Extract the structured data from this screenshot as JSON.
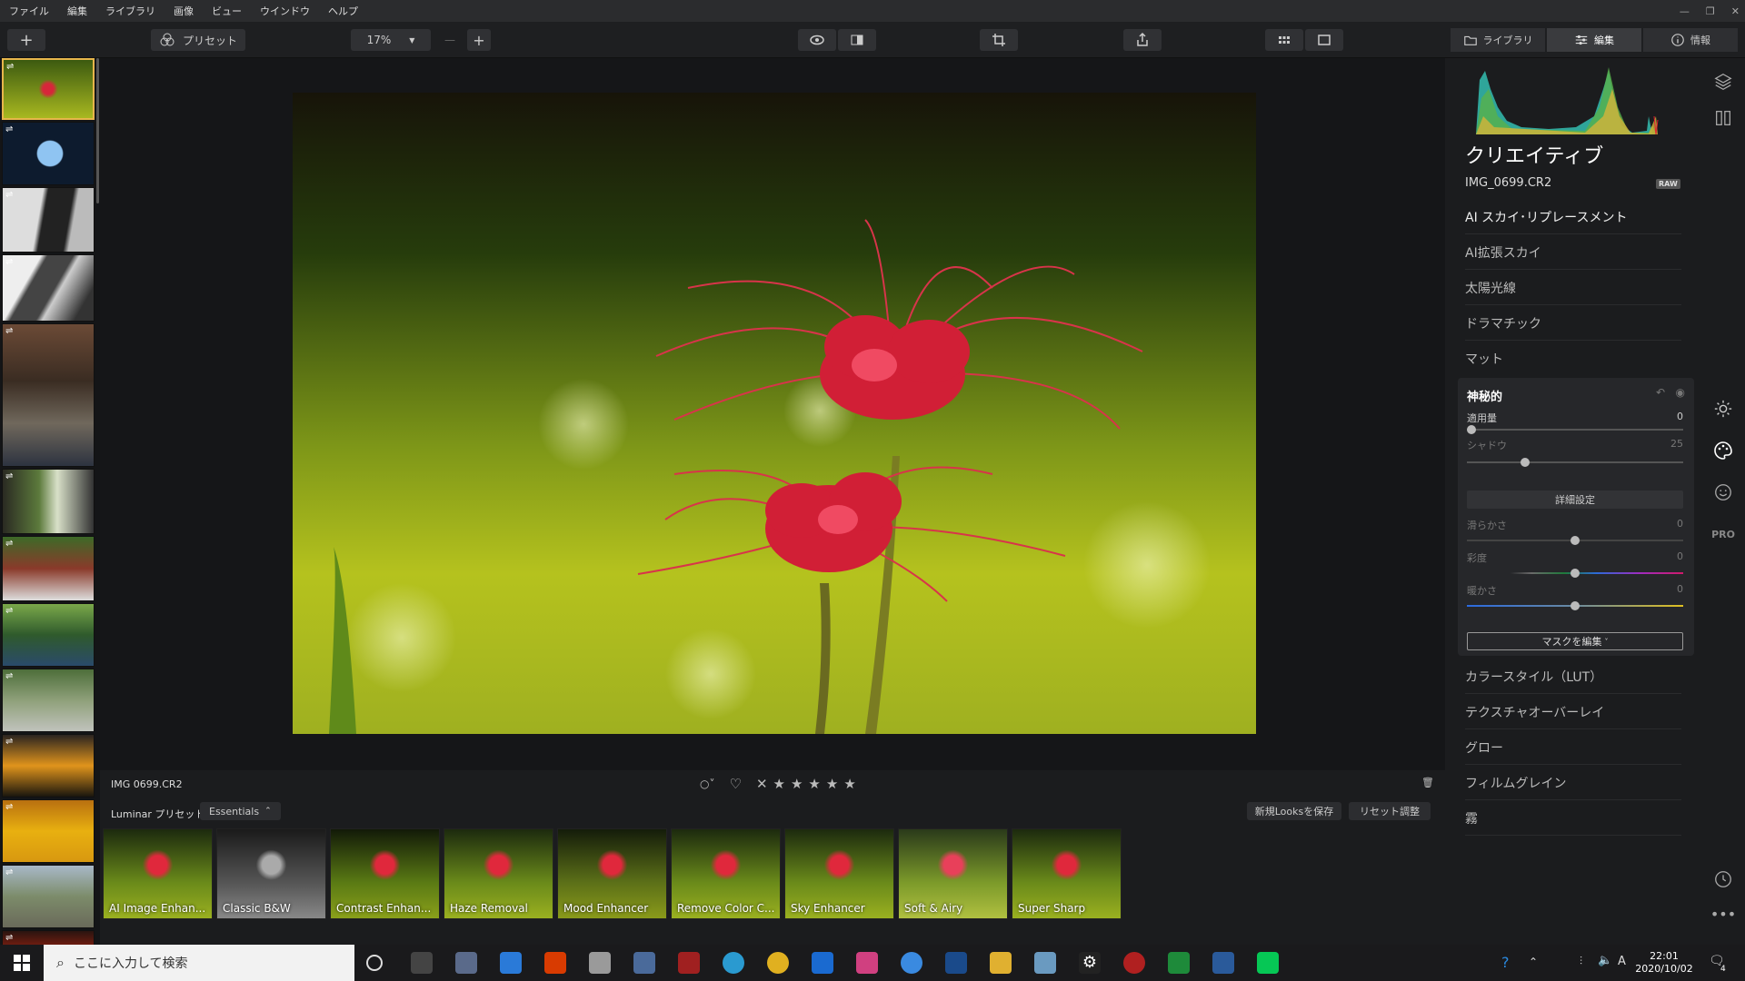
{
  "menu": [
    "ファイル",
    "編集",
    "ライブラリ",
    "画像",
    "ビュー",
    "ウインドウ",
    "ヘルプ"
  ],
  "toolbar": {
    "preset_label": "プリセット",
    "zoom": "17%",
    "tab_library": "ライブラリ",
    "tab_edit": "編集",
    "tab_info": "情報"
  },
  "viewer": {
    "filename": "IMG 0699.CR2"
  },
  "presetbar": {
    "title": "Luminar プリセット",
    "category": "Essentials",
    "save_looks": "新規Looksを保存",
    "reset": "リセット調整"
  },
  "presets": [
    {
      "label": "AI Image Enhan..."
    },
    {
      "label": "Classic B&W"
    },
    {
      "label": "Contrast Enhan..."
    },
    {
      "label": "Haze Removal"
    },
    {
      "label": "Mood Enhancer"
    },
    {
      "label": "Remove Color C..."
    },
    {
      "label": "Sky Enhancer"
    },
    {
      "label": "Soft & Airy"
    },
    {
      "label": "Super Sharp"
    }
  ],
  "panel": {
    "title": "クリエイティブ",
    "image_name": "IMG_0699.CR2",
    "raw_badge": "RAW",
    "tools_top": [
      "AI スカイ･リプレースメント",
      "AI拡張スカイ",
      "太陽光線",
      "ドラマチック",
      "マット"
    ],
    "mystic": {
      "title": "神秘的",
      "amount_label": "適用量",
      "amount_value": "0",
      "shadow_label": "シャドウ",
      "shadow_value": "25",
      "advanced": "詳細設定",
      "smooth_label": "滑らかさ",
      "smooth_value": "0",
      "saturation_label": "彩度",
      "saturation_value": "0",
      "warmth_label": "暖かさ",
      "warmth_value": "0",
      "edit_mask": "マスクを編集"
    },
    "tools_bottom": [
      "カラースタイル（LUT）",
      "テクスチャオーバーレイ",
      "グロー",
      "フィルムグレイン",
      "霧"
    ]
  },
  "taskbar": {
    "search_placeholder": "ここに入力して検索",
    "time": "22:01",
    "date": "2020/10/02",
    "ime": "A",
    "notif_count": "4"
  },
  "colors": {
    "accent": "#e7b64b",
    "background": "#1b1c1e"
  }
}
